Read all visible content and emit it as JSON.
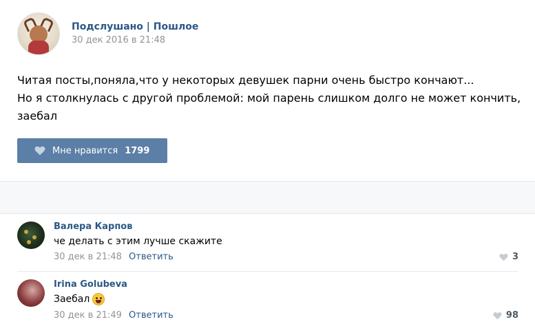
{
  "post": {
    "author": "Подслушано | Пошлое",
    "date": "30 дек 2016 в 21:48",
    "text_lines": [
      "Читая посты,поняла,что у некоторых девушек парни очень быстро кончают...",
      "Но я столкнулась с другой проблемой: мой парень слишком долго не может кончить,",
      "заебал"
    ],
    "like_label": "Мне нравится",
    "like_count": "1799"
  },
  "comments": [
    {
      "author": "Валера Карпов",
      "text": "че делать с этим лучше скажите",
      "date": "30 дек в 21:48",
      "reply_label": "Ответить",
      "likes": "3"
    },
    {
      "author": "Irina Golubeva",
      "text": "Заебал",
      "date": "30 дек в 21:49",
      "reply_label": "Ответить",
      "likes": "98"
    }
  ],
  "colors": {
    "link": "#2a5885",
    "like_button": "#5b7fa6",
    "meta": "#939393"
  }
}
